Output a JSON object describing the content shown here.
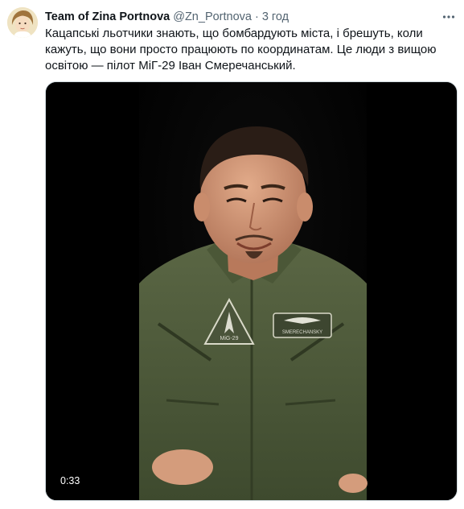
{
  "tweet": {
    "author_name": "Team of Zina Portnova",
    "handle": "@Zn_Portnova",
    "separator": "·",
    "time": "3 год",
    "text": "Кацапські льотчики знають, що бомбардують міста, і брешуть, коли кажуть, що вони просто працюють по координатам. Це люди з вищою освітою — пілот МіГ-29 Іван Смеречанський."
  },
  "media": {
    "duration": "0:33",
    "patch_left_text": "MiG-29",
    "patch_right_text": "SMERECHANSKY"
  },
  "icons": {
    "more": "more-horizontal-icon",
    "avatar": "avatar-image"
  },
  "colors": {
    "name": "#0f1419",
    "secondary": "#536471",
    "border": "#cfd9de",
    "video_bg": "#000000",
    "flight_suit": "#4e5a3a"
  }
}
